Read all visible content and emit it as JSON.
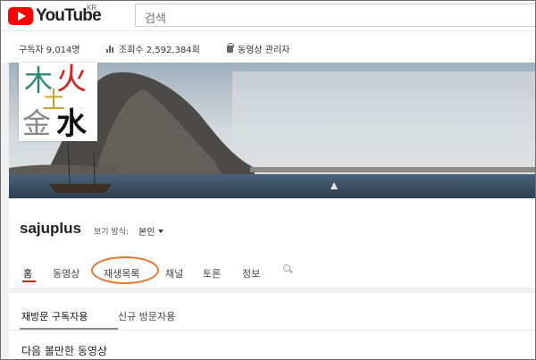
{
  "masthead": {
    "logo_text": "YouTube",
    "region": "KR",
    "search_placeholder": "검색"
  },
  "stats": {
    "subscribers": "구독자 9,014명",
    "views": "조회수 2,592,384회",
    "manager": "동영상 관리자"
  },
  "avatar": {
    "glyphs": [
      "木",
      "火",
      "土",
      "金",
      "水"
    ]
  },
  "channel": {
    "name": "sajuplus",
    "view_as_label": "보기 방식:",
    "view_as_value": "본인"
  },
  "tabs": [
    {
      "label": "홈"
    },
    {
      "label": "동영상"
    },
    {
      "label": "재생목록"
    },
    {
      "label": "채널"
    },
    {
      "label": "토론"
    },
    {
      "label": "정보"
    }
  ],
  "subtabs": [
    {
      "label": "재방문 구독자용"
    },
    {
      "label": "신규 방문자용"
    }
  ],
  "section_title": "다음 볼만한 동영상",
  "colors": {
    "brand_red": "#ff0000",
    "active_tab": "#cc1a1a",
    "highlight_circle": "#e8772e",
    "wood": "#2c8a6e",
    "fire": "#d62020",
    "earth": "#c9a227",
    "metal": "#888888",
    "water": "#111111"
  }
}
